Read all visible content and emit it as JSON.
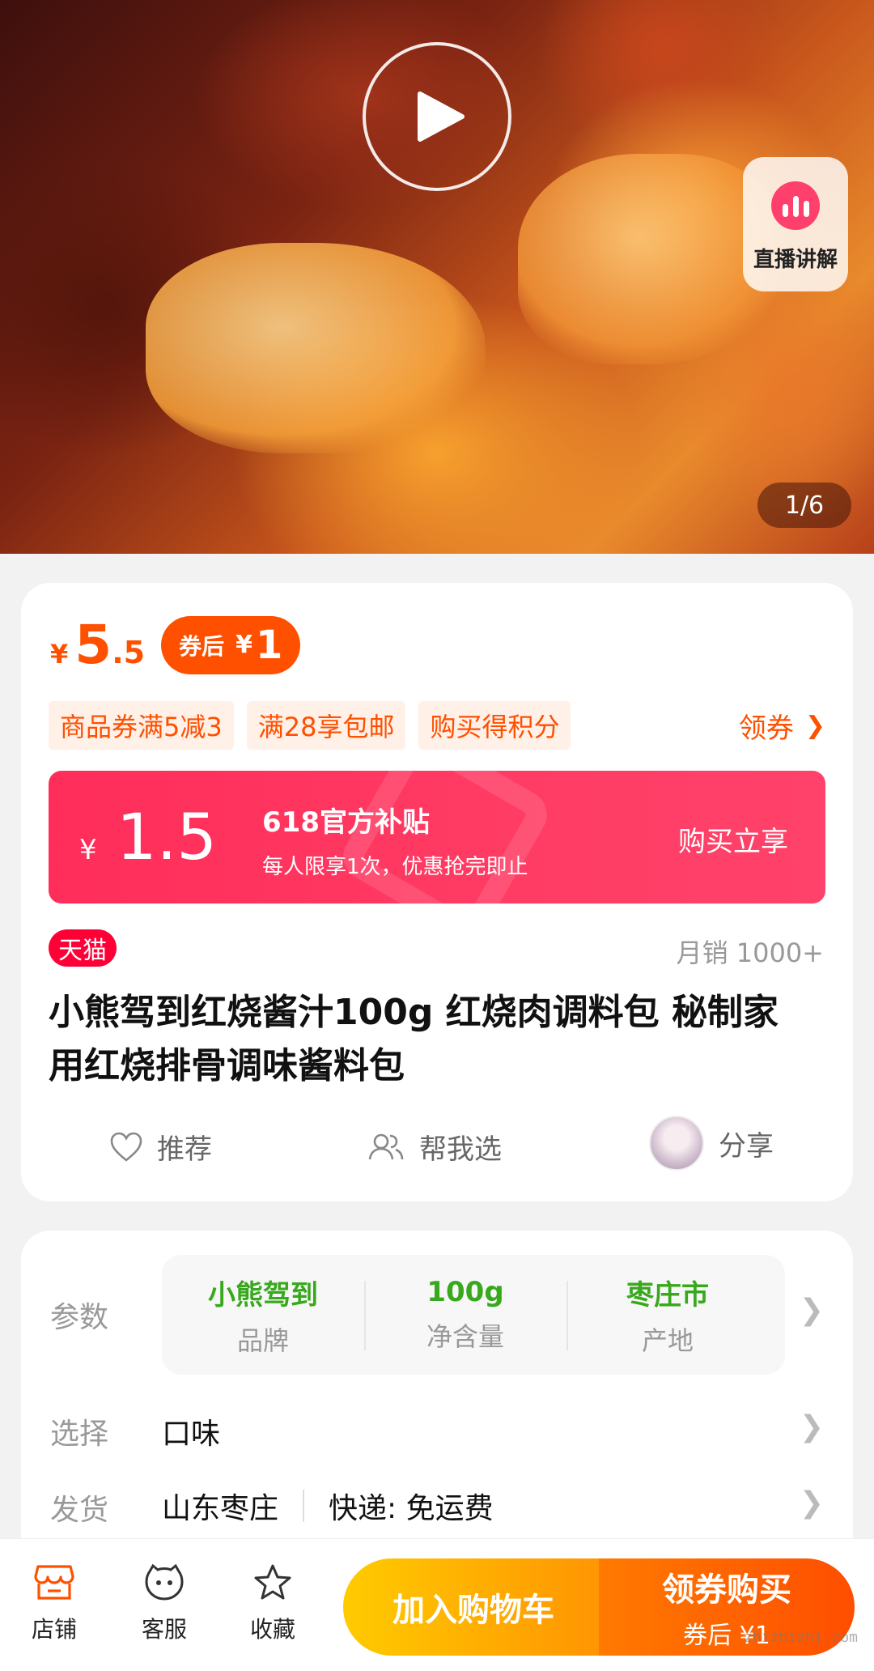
{
  "hero": {
    "live_label": "直播讲解",
    "page_indicator": "1/6"
  },
  "price": {
    "currency": "¥",
    "integer": "5",
    "decimal": ".5",
    "after_coupon_label": "券后",
    "after_coupon_currency": "¥",
    "after_coupon_value": "1"
  },
  "promo_tags": [
    "商品券满5减3",
    "满28享包邮",
    "购买得积分"
  ],
  "coupon_link": "领券",
  "subsidy": {
    "currency": "¥",
    "value": "1.5",
    "title": "618官方补贴",
    "desc": "每人限享1次，优惠抢完即止",
    "cta": "购买立享"
  },
  "tmall_badge": "天猫",
  "monthly_sales": "月销 1000+",
  "product_title": "小熊驾到红烧酱汁100g 红烧肉调料包 秘制家用红烧排骨调味酱料包",
  "actions": {
    "recommend": "推荐",
    "help_choose": "帮我选",
    "share": "分享"
  },
  "params": {
    "label": "参数",
    "items": [
      {
        "value": "小熊驾到",
        "key": "品牌"
      },
      {
        "value": "100g",
        "key": "净含量"
      },
      {
        "value": "枣庄市",
        "key": "产地"
      }
    ]
  },
  "select": {
    "label": "选择",
    "value": "口味"
  },
  "shipping": {
    "label": "发货",
    "origin": "山东枣庄",
    "express": "快递: 免运费"
  },
  "bottom_nav": {
    "store": "店铺",
    "service": "客服",
    "favorite": "收藏",
    "add_cart": "加入购物车",
    "buy_main": "领券购买",
    "buy_sub": "券后 ¥1"
  },
  "watermark": "zhizhizhi.com",
  "colors": {
    "accent": "#ff5000",
    "subsidy": "#ff2d5a",
    "tmall": "#ff0036",
    "param_green": "#38a81d"
  }
}
